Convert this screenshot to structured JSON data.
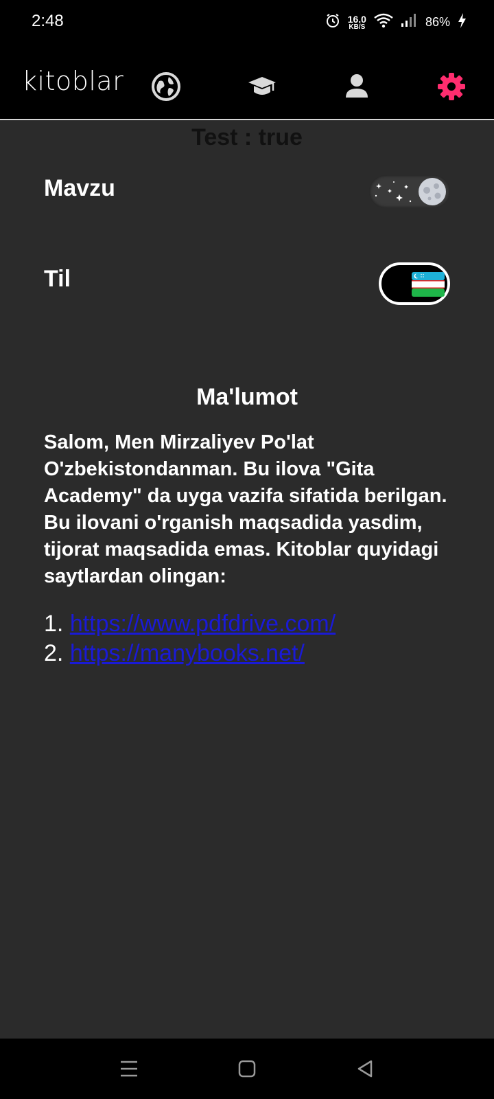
{
  "status_bar": {
    "time": "2:48",
    "net_speed_value": "16.0",
    "net_speed_unit": "KB/S",
    "battery": "86%",
    "icons": [
      "alarm-icon",
      "wifi-icon",
      "signal-icon",
      "charging-icon"
    ]
  },
  "app_bar": {
    "title": "kitoblar",
    "nav_icons": [
      "globe-icon",
      "graduation-cap-icon",
      "user-icon",
      "gear-icon"
    ],
    "active_icon": "gear-icon",
    "active_color": "#ff2d6f",
    "icon_color": "#d9d9d9"
  },
  "settings": {
    "test_line": "Test : true",
    "theme_label": "Mavzu",
    "theme_mode": "dark",
    "language_label": "Til",
    "language_flag": "uzbekistan-flag-icon"
  },
  "info": {
    "title": "Ma'lumot",
    "body": "Salom, Men Mirzaliyev Po'lat O'zbekistondanman. Bu ilova \"Gita Academy\" da uyga vazifa sifatida berilgan. Bu ilovani o'rganish maqsadida yasdim, tijorat maqsadida emas. Kitoblar quyidagi saytlardan olingan:",
    "links": [
      {
        "number": "1.",
        "url": "https://www.pdfdrive.com/"
      },
      {
        "number": "2.",
        "url": "https://manybooks.net/"
      }
    ]
  },
  "colors": {
    "background": "#2b2b2b",
    "bar": "#000000",
    "link": "#1a1ad6"
  },
  "system_nav": {
    "buttons": [
      "menu-icon",
      "home-icon",
      "back-icon"
    ]
  }
}
